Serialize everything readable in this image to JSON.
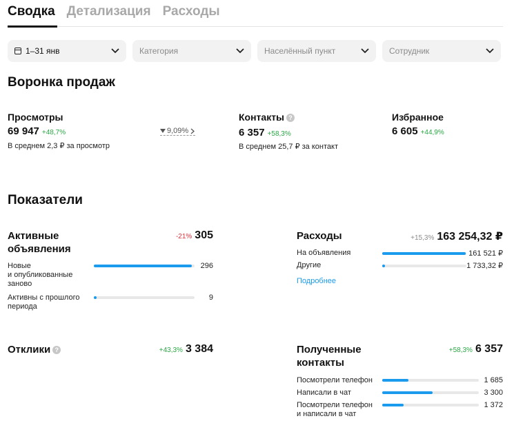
{
  "tabs": [
    {
      "label": "Сводка",
      "active": true
    },
    {
      "label": "Детализация",
      "active": false
    },
    {
      "label": "Расходы",
      "active": false
    }
  ],
  "filters": {
    "date": "1–31 янв",
    "category": "Категория",
    "locality": "Населённый пункт",
    "employee": "Сотрудник"
  },
  "funnel": {
    "title": "Воронка продаж",
    "views": {
      "title": "Просмотры",
      "value": "69 947",
      "delta": "+48,7%",
      "note": "В среднем 2,3 ₽ за просмотр"
    },
    "conversion": "9,09%",
    "contacts": {
      "title": "Контакты",
      "value": "6 357",
      "delta": "+58,3%",
      "note": "В среднем 25,7 ₽ за контакт"
    },
    "favorites": {
      "title": "Избранное",
      "value": "6 605",
      "delta": "+44,9%"
    }
  },
  "indicators": {
    "title": "Показатели",
    "active_ads": {
      "title_line1": "Активные",
      "title_line2": "объявления",
      "delta": "-21%",
      "total": "305",
      "rows": [
        {
          "label1": "Новые",
          "label2": "и опубликованные",
          "label3": "заново",
          "value": "296",
          "fraction": 0.97
        },
        {
          "label1": "Активны с прошлого",
          "label2": "периода",
          "value": "9",
          "fraction": 0.03
        }
      ]
    },
    "expenses": {
      "title": "Расходы",
      "delta": "+15,3%",
      "total": "163 254,32 ₽",
      "rows": [
        {
          "label": "На объявления",
          "value": "161 521 ₽",
          "fraction": 0.99
        },
        {
          "label": "Другие",
          "value": "1 733,32 ₽",
          "fraction": 0.03
        }
      ],
      "link": "Подробнее"
    },
    "responses": {
      "title": "Отклики",
      "delta": "+43,3%",
      "total": "3 384"
    },
    "received_contacts": {
      "title_line1": "Полученные",
      "title_line2": "контакты",
      "delta": "+58,3%",
      "total": "6 357",
      "rows": [
        {
          "label1": "Посмотрели телефон",
          "value": "1 685",
          "fraction": 0.27
        },
        {
          "label1": "Написали в чат",
          "value": "3 300",
          "fraction": 0.52
        },
        {
          "label1": "Посмотрели телефон",
          "label2": "и написали в чат",
          "value": "1 372",
          "fraction": 0.22
        }
      ]
    }
  }
}
